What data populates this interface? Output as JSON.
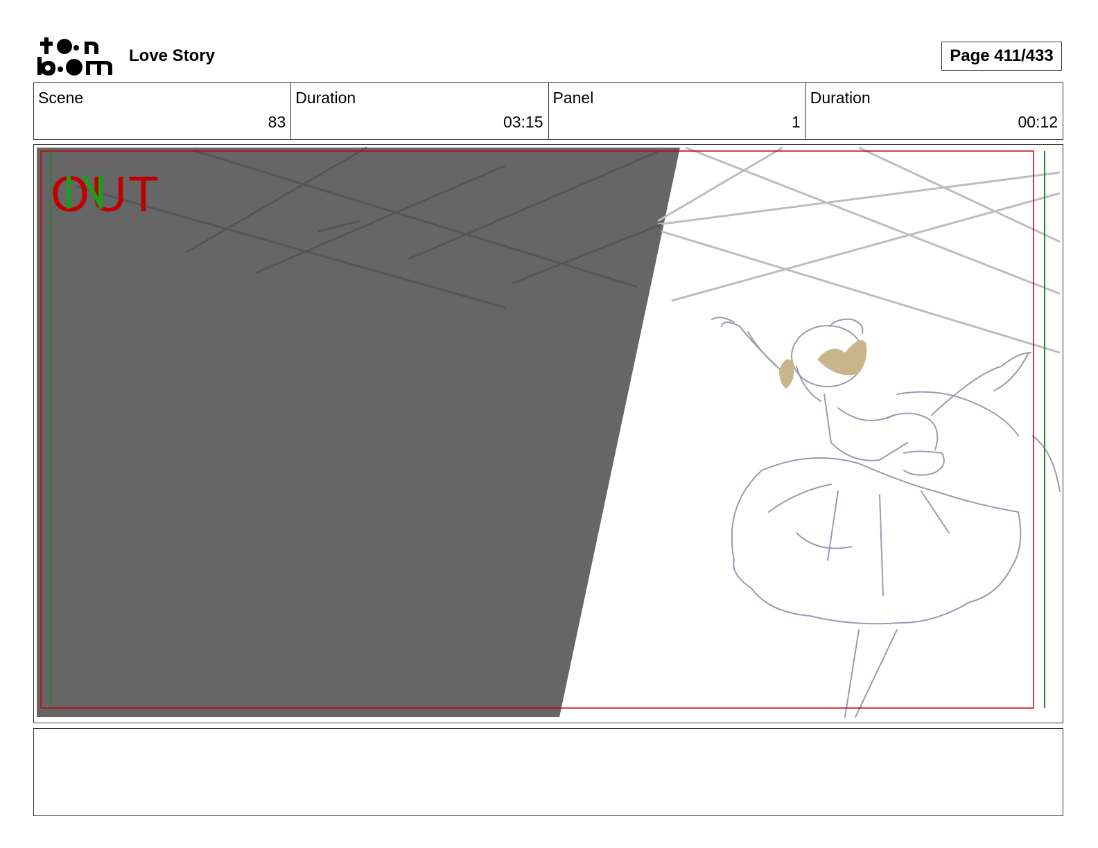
{
  "header": {
    "logo_text": "toon boom",
    "project_title": "Love Story",
    "page_label": "Page 411/433"
  },
  "info": {
    "scene_label": "Scene",
    "scene_value": "83",
    "scene_duration_label": "Duration",
    "scene_duration_value": "03:15",
    "panel_label": "Panel",
    "panel_value": "1",
    "panel_duration_label": "Duration",
    "panel_duration_value": "00:12"
  },
  "panel": {
    "overlay_text": "OUT",
    "colors": {
      "shadow": "#666666",
      "safe_frame": "#c00000",
      "title_safe": "#2e7d32",
      "sketch": "#9a9ab0",
      "hair": "#c8b68a",
      "lattice": "#bdbdbd"
    }
  },
  "notes": {}
}
